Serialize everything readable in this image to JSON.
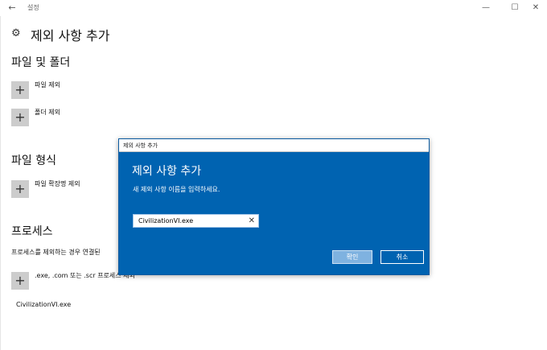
{
  "window": {
    "app_title": "설정",
    "back_glyph": "←",
    "min_glyph": "—",
    "max_glyph": "☐",
    "close_glyph": "✕"
  },
  "page": {
    "title": "제외 사항 추가",
    "gear_glyph": "⚙"
  },
  "sections": {
    "files_folders": {
      "title": "파일 및 폴더",
      "add_file_label": "파일 제외",
      "add_folder_label": "폴더 제외"
    },
    "file_types": {
      "title": "파일 형식",
      "add_extension_label": "파일 확장명 제외"
    },
    "processes": {
      "title": "프로세스",
      "description": "프로세스를 제외하는 경우 연결된 ",
      "add_process_label": ".exe, .com 또는 .scr 프로세스 제외",
      "items": [
        "CivilizationVI.exe"
      ]
    }
  },
  "plus_glyph": "+",
  "dialog": {
    "titlebar": "제외 사항 추가",
    "heading": "제외 사항 추가",
    "prompt": "새 제외 사항 이름을 입력하세요.",
    "input_value": "CivilizationVI.exe",
    "clear_glyph": "✕",
    "ok_label": "확인",
    "cancel_label": "취소"
  }
}
